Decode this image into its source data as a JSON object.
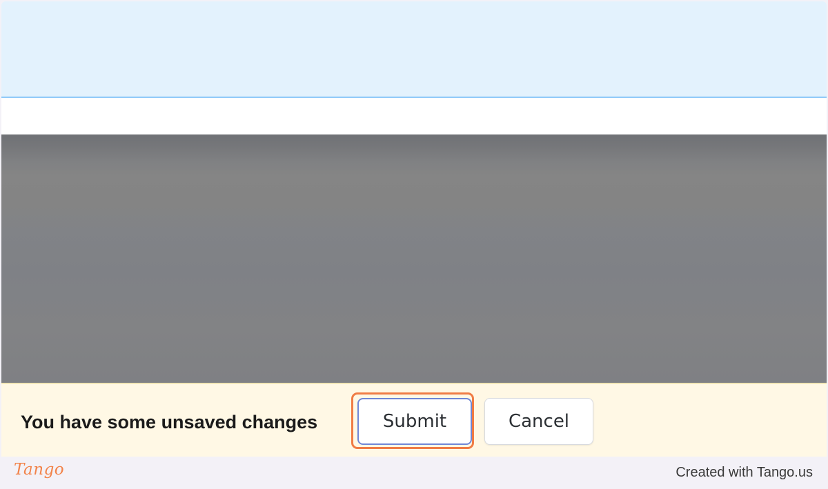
{
  "unsaved_bar": {
    "message": "You have some unsaved changes",
    "submit_label": "Submit",
    "cancel_label": "Cancel"
  },
  "footer": {
    "logo_text": "Tango",
    "credit_text": "Created with Tango.us"
  },
  "colors": {
    "highlight": "#f07c45",
    "banner_bg": "#fff8e5",
    "top_band": "#e3f2fd",
    "overlay": "#808183"
  }
}
